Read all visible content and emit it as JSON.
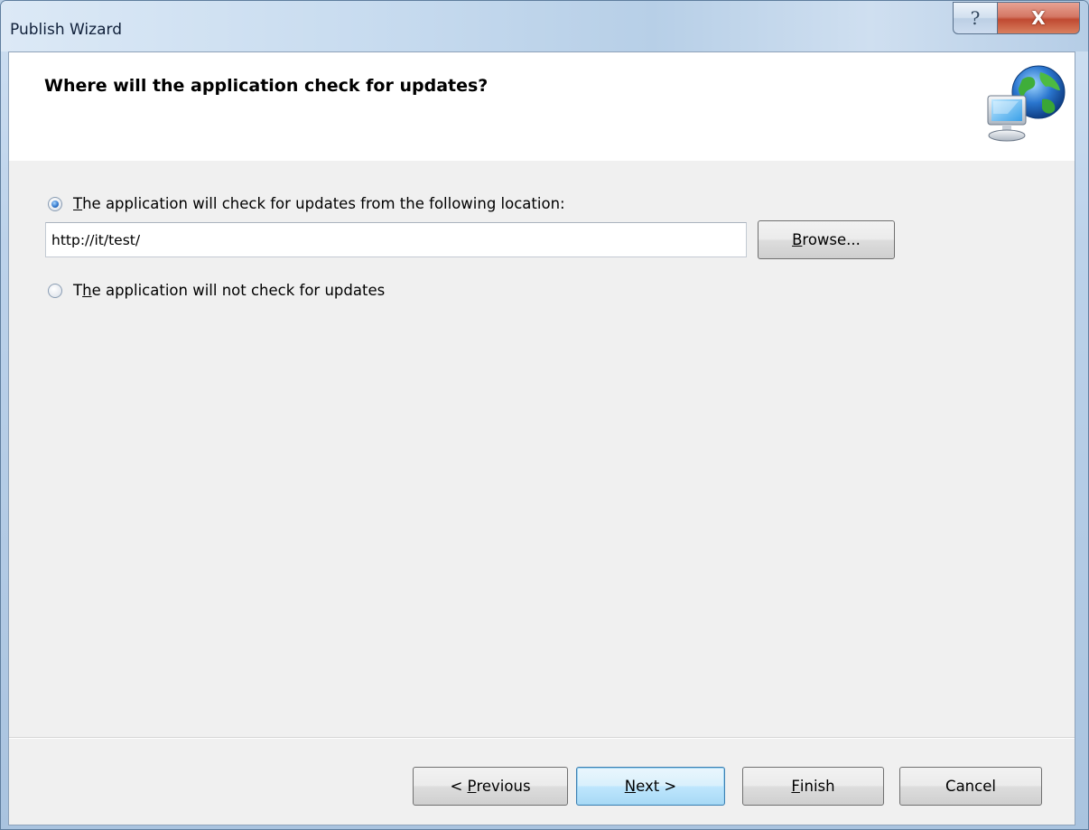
{
  "window": {
    "title": "Publish Wizard",
    "help_glyph": "?",
    "close_glyph": "X"
  },
  "header": {
    "title": "Where will the application check for updates?",
    "icon": "network-globe-icon"
  },
  "options": {
    "check_location": {
      "mnemonic": "T",
      "label_rest": "he application will check for updates from the following location:",
      "selected": true
    },
    "no_check": {
      "label_start": "T",
      "mnemonic": "h",
      "label_rest": "e application will not check for updates",
      "selected": false
    }
  },
  "location_input": {
    "value": "http://it/test/"
  },
  "buttons": {
    "browse": {
      "mnemonic": "B",
      "rest": "rowse..."
    },
    "previous": {
      "prefix": "< ",
      "mnemonic": "P",
      "rest": "revious"
    },
    "next": {
      "mnemonic": "N",
      "rest": "ext >"
    },
    "finish": {
      "mnemonic": "F",
      "rest": "inish"
    },
    "cancel": {
      "label": "Cancel"
    }
  },
  "colors": {
    "title_bar": "#c7dbef",
    "close_button": "#c04a32",
    "default_button": "#bee6fd",
    "radio_selected": "#2e73c9",
    "client_background": "#f0f0f0"
  }
}
